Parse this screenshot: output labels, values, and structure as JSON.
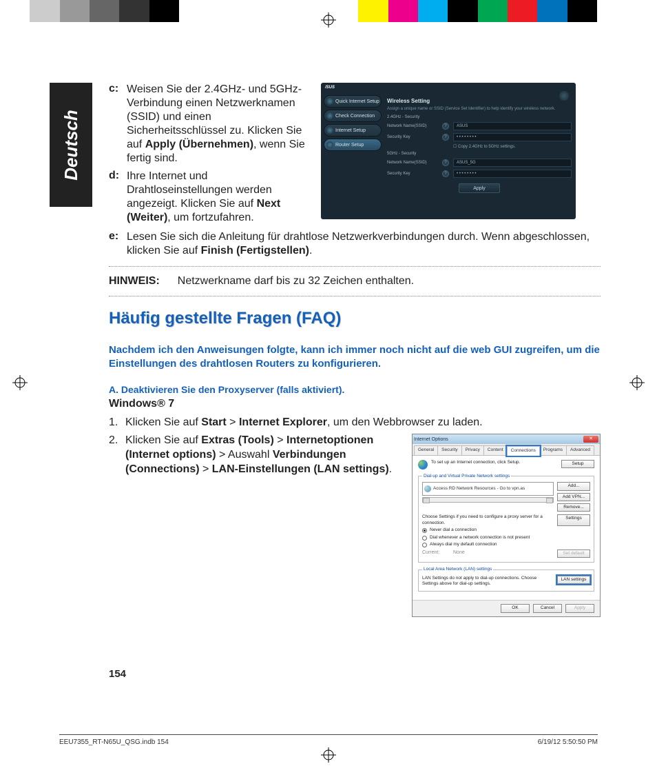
{
  "regColors": [
    "#00aeef",
    "#ec008c",
    "#fff200",
    "#000",
    "#00a651",
    "#ed1c24",
    "#0072bc",
    "#000",
    "#fff",
    "#fff",
    "#ccc",
    "#999",
    "#666",
    "#333",
    "#000",
    "#fff",
    "#fff",
    "#fff",
    "#fff"
  ],
  "language": "Deutsch",
  "items": {
    "c": {
      "mark": "c:",
      "text_pre": "Weisen Sie der 2.4GHz- und 5GHz-Verbindung einen Netzwerknamen (SSID) und einen Sicherheitsschlüssel zu. Klicken Sie auf ",
      "bold": "Apply (Übernehmen)",
      "text_post": ", wenn Sie fertig sind."
    },
    "d": {
      "mark": "d:",
      "text_pre": "Ihre Internet und Drahtloseinstellungen werden angezeigt. Klicken Sie auf ",
      "bold": "Next (Weiter)",
      "text_post": ", um fortzufahren."
    },
    "e": {
      "mark": "e:",
      "text_pre": "Lesen Sie sich die Anleitung für drahtlose Netzwerkverbindungen durch. Wenn abgeschlossen, klicken Sie auf ",
      "bold": "Finish (Fertigstellen)",
      "text_post": "."
    }
  },
  "router": {
    "logo": "/SUS",
    "side": [
      "Quick Internet Setup",
      "Check Connection",
      "Internet Setup",
      "Router Setup"
    ],
    "title": "Wireless Setting",
    "desc": "Assign a unique name or SSID (Service Set Identifier) to help identify your wireless network.",
    "sec24": "2.4GHz - Security",
    "sec5": "5GHz - Security",
    "lblName": "Network Name(SSID)",
    "lblKey": "Security Key",
    "val24": "ASUS",
    "valKey": "• • • • • • • •",
    "chk": "☐ Copy 2.4GHz to 5GHz settings.",
    "val5": "ASUS_5G",
    "apply": "Apply"
  },
  "hinweis": {
    "label": "HINWEIS:",
    "text": "Netzwerkname darf bis zu 32 Zeichen enthalten."
  },
  "faqTitle": "Häufig gestellte Fragen (FAQ)",
  "faqQ": "Nachdem ich den Anweisungen folgte, kann ich immer noch nicht auf die web GUI zugreifen, um die Einstellungen des drahtlosen Routers zu konfigurieren.",
  "faqSub": "A.   Deaktivieren Sie den Proxyserver (falls aktiviert).",
  "win7": "Windows® 7",
  "steps": {
    "s1": {
      "n": "1.",
      "pre": "Klicken Sie auf ",
      "b1": "Start",
      "mid1": " > ",
      "b2": "Internet Explorer",
      "post": ", um den Webbrowser zu laden."
    },
    "s2": {
      "n": "2.",
      "pre": "Klicken Sie auf ",
      "b1": "Extras (Tools)",
      "mid1": " > ",
      "b2": "Internetoptionen (Internet options)",
      "mid2": " > Auswahl ",
      "b3": "Verbindungen (Connections)",
      "mid3": " > ",
      "b4": "LAN-Einstellungen (LAN settings)",
      "post": "."
    }
  },
  "ie": {
    "title": "Internet Options",
    "tabs": [
      "General",
      "Security",
      "Privacy",
      "Content",
      "Connections",
      "Programs",
      "Advanced"
    ],
    "setupText": "To set up an Internet connection, click Setup.",
    "setupBtn": "Setup",
    "dialLegend": "Dial-up and Virtual Private Network settings",
    "listItem": "Access RD Network Resources - Go to vpn.as",
    "addBtn": "Add...",
    "addVpnBtn": "Add VPN...",
    "removeBtn": "Remove...",
    "chooseText": "Choose Settings if you need to configure a proxy server for a connection.",
    "settingsBtn": "Settings",
    "r1": "Never dial a connection",
    "r2": "Dial whenever a network connection is not present",
    "r3": "Always dial my default connection",
    "current": "Current:",
    "none": "None",
    "setDefault": "Set default",
    "lanLegend": "Local Area Network (LAN) settings",
    "lanText": "LAN Settings do not apply to dial-up connections. Choose Settings above for dial-up settings.",
    "lanBtn": "LAN settings",
    "ok": "OK",
    "cancel": "Cancel",
    "applyBtn": "Apply"
  },
  "pageNum": "154",
  "footerFile": "EEU7355_RT-N65U_QSG.indb   154",
  "footerDate": "6/19/12   5:50:50 PM"
}
